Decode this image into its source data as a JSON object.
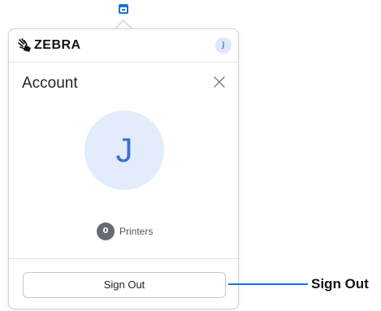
{
  "tray": {
    "icon": "printer-app-icon",
    "accent": "#1976d2"
  },
  "header": {
    "logo_icon": "zebra-head-logo",
    "brand": "ZEBRA",
    "avatar_initial": "J"
  },
  "account": {
    "title": "Account",
    "close_icon": "close-icon",
    "avatar_initial": "J",
    "printer_count": "0",
    "printer_label": "Printers"
  },
  "footer": {
    "sign_out_label": "Sign Out"
  },
  "annotation": {
    "callout_label": "Sign Out",
    "color": "#1c6fe0"
  }
}
